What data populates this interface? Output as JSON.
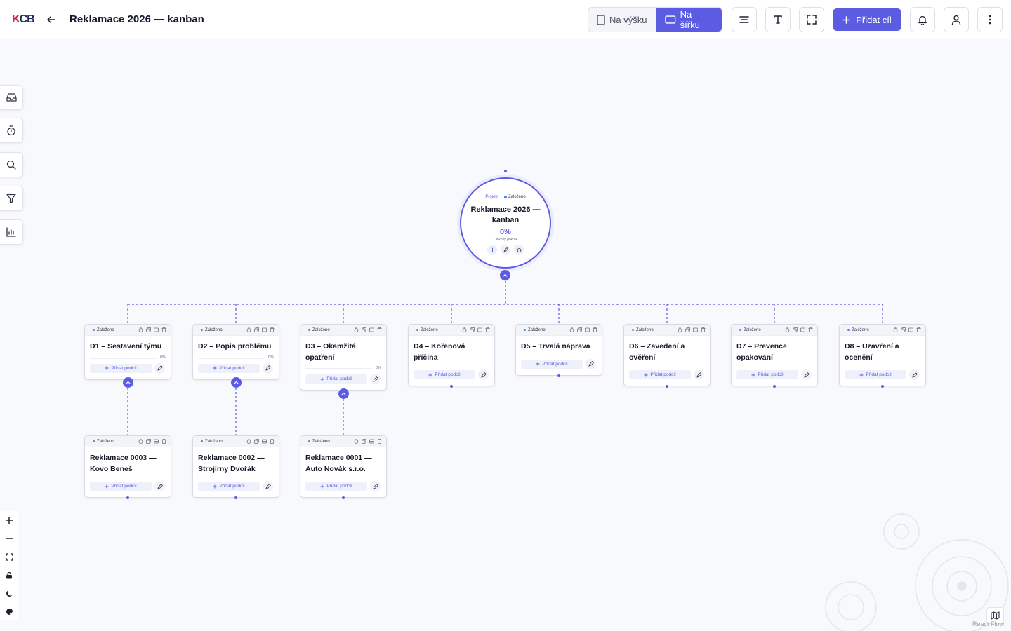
{
  "header": {
    "logo_left": "K",
    "logo_right": "CB",
    "title": "Reklamace 2026 — kanban",
    "orient_portrait": "Na výšku",
    "orient_landscape": "Na šířku",
    "add_goal": "Přidat cíl"
  },
  "root": {
    "tag_project": "Projekt",
    "status": "Založeno",
    "title": "Reklamace 2026 — kanban",
    "progress_label": "0%",
    "progress_sub": "Celkový pokrok"
  },
  "cards": [
    {
      "status": "Založeno",
      "title": "D1 – Sestavení týmu",
      "progress": "0%",
      "add_sub": "Přidat podcíl"
    },
    {
      "status": "Založeno",
      "title": "D2 – Popis problému",
      "progress": "0%",
      "add_sub": "Přidat podcíl"
    },
    {
      "status": "Založeno",
      "title": "D3 – Okamžitá opatření",
      "progress": "0%",
      "add_sub": "Přidat podcíl"
    },
    {
      "status": "Založeno",
      "title": "D4 – Kořenová příčina",
      "add_sub": "Přidat podcíl"
    },
    {
      "status": "Založeno",
      "title": "D5 – Trvalá náprava",
      "add_sub": "Přidat podcíl"
    },
    {
      "status": "Založeno",
      "title": "D6 – Zavedení a ověření",
      "add_sub": "Přidat podcíl"
    },
    {
      "status": "Založeno",
      "title": "D7 – Prevence opakování",
      "add_sub": "Přidat podcíl"
    },
    {
      "status": "Založeno",
      "title": "D8 – Uzavření a ocenění",
      "add_sub": "Přidat podcíl"
    }
  ],
  "children": [
    {
      "status": "Založeno",
      "title": "Reklamace 0003 — Kovo Beneš",
      "add_sub": "Přidat podcíl"
    },
    {
      "status": "Založeno",
      "title": "Reklamace 0002 — Strojírny Dvořák",
      "add_sub": "Přidat podcíl"
    },
    {
      "status": "Založeno",
      "title": "Reklamace 0001 — Auto Novák s.r.o.",
      "add_sub": "Přidat podcíl"
    }
  ],
  "footer": {
    "attribution": "React Flow"
  },
  "colors": {
    "accent": "#5b5ce2",
    "status_dot": "#3b82f6",
    "background": "#f8f9fc"
  }
}
